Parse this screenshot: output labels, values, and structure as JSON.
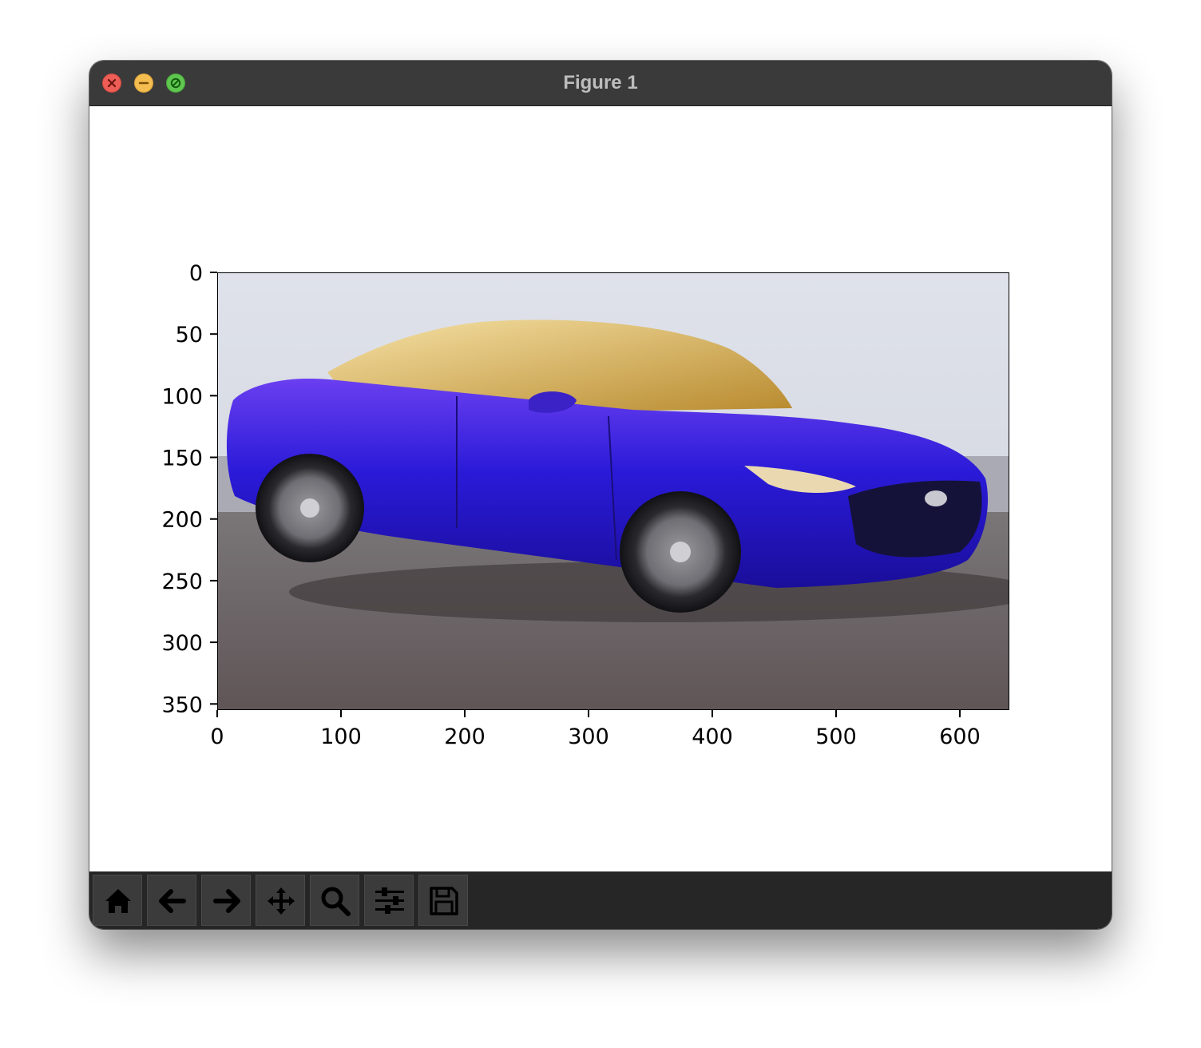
{
  "window": {
    "title": "Figure 1",
    "controls": [
      "close-icon",
      "minimize-icon",
      "zoom-icon"
    ]
  },
  "toolbar": {
    "buttons": [
      {
        "name": "home",
        "icon": "home-icon"
      },
      {
        "name": "back",
        "icon": "arrow-left-icon"
      },
      {
        "name": "forward",
        "icon": "arrow-right-icon"
      },
      {
        "name": "pan",
        "icon": "move-arrows-icon"
      },
      {
        "name": "zoom",
        "icon": "magnifier-icon"
      },
      {
        "name": "configure-subplots",
        "icon": "sliders-icon"
      },
      {
        "name": "save",
        "icon": "floppy-disk-icon"
      }
    ]
  },
  "figure": {
    "image_subject": "blue sedan car",
    "x_ticks": [
      0,
      100,
      200,
      300,
      400,
      500,
      600
    ],
    "y_ticks": [
      0,
      50,
      100,
      150,
      200,
      250,
      300,
      350
    ],
    "xlim": [
      0,
      640
    ],
    "ylim": [
      355,
      0
    ]
  },
  "colors": {
    "titlebar": "#3a3a3a",
    "toolbar": "#262626",
    "car_body": "#3a22d6",
    "sky": "#d7dbe3",
    "road": "#6e6a6c"
  }
}
